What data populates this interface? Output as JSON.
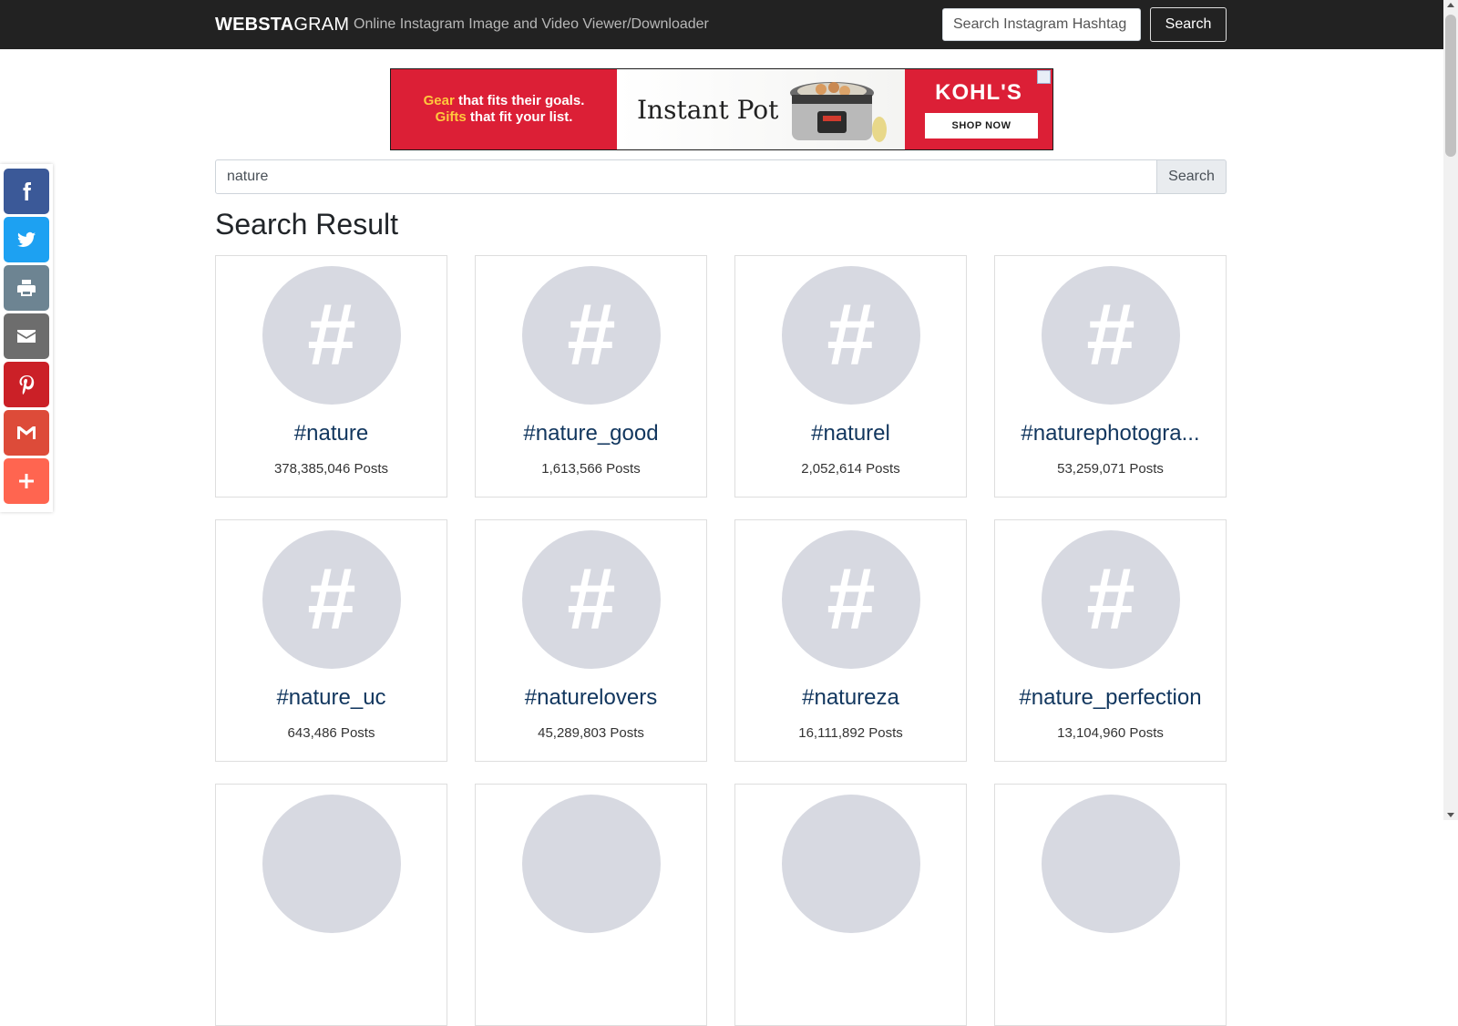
{
  "navbar": {
    "brand_bold": "WEBSTA",
    "brand_light": "GRAM",
    "tagline": "Online Instagram Image and Video Viewer/Downloader",
    "search_placeholder": "Search Instagram Hashtag",
    "search_button": "Search"
  },
  "ad": {
    "line1_highlight": "Gear",
    "line1_rest": " that fits their goals.",
    "line2_highlight": "Gifts",
    "line2_rest": " that fit your list.",
    "product_brand": "Instant Pot",
    "retailer": "KOHL'S",
    "cta": "SHOP NOW"
  },
  "main_search": {
    "value": "nature",
    "button": "Search"
  },
  "results": {
    "heading": "Search Result",
    "hash_symbol": "#",
    "cards": [
      {
        "tag": "#nature",
        "posts": "378,385,046 Posts"
      },
      {
        "tag": "#nature_good",
        "posts": "1,613,566 Posts"
      },
      {
        "tag": "#naturel",
        "posts": "2,052,614 Posts"
      },
      {
        "tag": "#naturephotogra...",
        "posts": "53,259,071 Posts"
      },
      {
        "tag": "#nature_uc",
        "posts": "643,486 Posts"
      },
      {
        "tag": "#naturelovers",
        "posts": "45,289,803 Posts"
      },
      {
        "tag": "#natureza",
        "posts": "16,111,892 Posts"
      },
      {
        "tag": "#nature_perfection",
        "posts": "13,104,960 Posts"
      },
      {
        "tag": "",
        "posts": ""
      },
      {
        "tag": "",
        "posts": ""
      },
      {
        "tag": "",
        "posts": ""
      },
      {
        "tag": "",
        "posts": ""
      }
    ]
  },
  "share": [
    {
      "name": "facebook-icon",
      "color": "#3b5998"
    },
    {
      "name": "twitter-icon",
      "color": "#1da1f2"
    },
    {
      "name": "print-icon",
      "color": "#6d8492"
    },
    {
      "name": "email-icon",
      "color": "#6d6d6d"
    },
    {
      "name": "pinterest-icon",
      "color": "#cb2027"
    },
    {
      "name": "gmail-icon",
      "color": "#dd4b39"
    },
    {
      "name": "more-share-icon",
      "color": "#ff6550"
    }
  ]
}
